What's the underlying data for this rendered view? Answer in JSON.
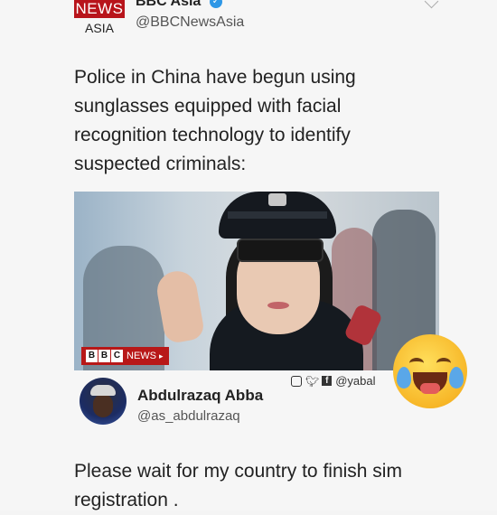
{
  "header": {
    "logo_top": "NEWS",
    "logo_bottom": "ASIA",
    "account_name": "BBC Asia",
    "account_handle": "@BBCNewsAsia"
  },
  "tweet": {
    "text": "Police in China have begun using sunglasses equipped with facial recognition technology to identify suspected criminals:"
  },
  "photo": {
    "bbc_letters": [
      "B",
      "B",
      "C"
    ],
    "bbc_news_label": "NEWS"
  },
  "watermark": {
    "handle": "@yabal"
  },
  "reply": {
    "name": "Abdulrazaq Abba",
    "handle": "@as_abdulrazaq",
    "text": "Please wait for my country to finish sim registration ."
  },
  "colors": {
    "bbc_red": "#b8141b",
    "verified_blue": "#2e97e6"
  },
  "icons": [
    "verified-check-icon",
    "chevron-down-icon",
    "instagram-icon",
    "twitter-icon",
    "facebook-icon",
    "laughing-crying-emoji-icon"
  ]
}
